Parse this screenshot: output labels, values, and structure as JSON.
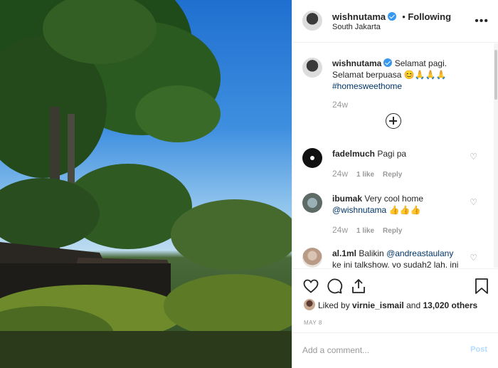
{
  "post_owner": {
    "username": "wishnutama",
    "follow_status": "Following",
    "location": "South Jakarta"
  },
  "caption": {
    "username": "wishnutama",
    "text": "Selamat pagi. Selamat berpuasa 😊🙏🙏🙏",
    "hashtag": "#homesweethome",
    "age": "24w"
  },
  "comments": [
    {
      "username": "fadelmuch",
      "text": "Pagi pa",
      "age": "24w",
      "likes": "1 like",
      "reply": "Reply"
    },
    {
      "username": "ibumak",
      "text": "Very cool home",
      "mention": "@wishnutama",
      "emoji": "👍👍👍",
      "age": "24w",
      "likes": "1 like",
      "reply": "Reply"
    },
    {
      "username": "al.1ml",
      "text": "Balikin",
      "mention": "@andreastaulany",
      "text2": "ke ini talkshow. yo sudah2 lah. ini"
    }
  ],
  "likes_line": {
    "prefix": "Liked by",
    "user": "virnie_ismail",
    "middle": "and",
    "count": "13,020 others"
  },
  "date": "MAY 8",
  "add_comment": {
    "placeholder": "Add a comment...",
    "post_label": "Post"
  },
  "icons": [
    "heart-icon",
    "comment-icon",
    "share-icon",
    "bookmark-icon",
    "more-icon",
    "add-comments-icon"
  ],
  "colors": {
    "link": "#003569",
    "verified": "#3897f0",
    "post_disabled": "#b3dbff"
  }
}
